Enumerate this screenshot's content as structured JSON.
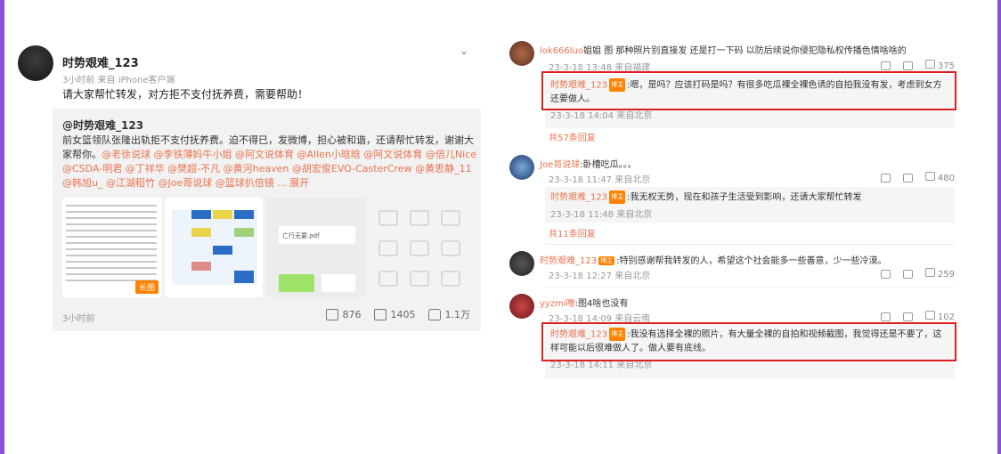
{
  "post": {
    "username": "时势艰难_123",
    "meta": "3小时前 来自 iPhone客户端",
    "text": "请大家帮忙转发，对方拒不支付抚养费，需要帮助！",
    "repost_author": "@时势艰难_123",
    "repost_body_plain": "前女篮领队张隆出轨拒不支付抚养费。迫不得已，发微博，担心被和谐，还请帮忙转发，谢谢大家帮你。",
    "repost_mentions": "@老徐说球 @李铁薄妈牛小姐 @阿文说体育 @Allen小晗晗 @阿文说体育 @倍儿Nice @CSDA-明君 @丁祥华 @樊超-不凡 @黄河heaven @胡宏俊EVO-CasterCrew @黄思静_11 @韩旭u_ @江湖稻竹 @Joe哥说球 @篮球扒倍镜 ... 展开",
    "thumb1_badge": "长图",
    "thumb3_file": "亡行无要.pdf",
    "time": "3小时前",
    "shares": "876",
    "comments": "1405",
    "likes": "1.1万",
    "icons": [
      "chevron-down-icon",
      "share-icon",
      "comment-icon",
      "like-icon"
    ]
  },
  "comments": [
    {
      "name": "lok666luo",
      "text": "姐姐 图 那种照片别直接发 还是打一下码 以防后续说你侵犯隐私权传播色情啥啥的",
      "meta": "23-3-18 13:48 来自福建",
      "likes": "375",
      "reply": {
        "name": "时势艰难_123",
        "badge": "博主",
        "text": ":嗯，是吗？应该打码是吗？有很多吃瓜裸全裸色诱的自拍我没有发，考虑到女方还要做人。",
        "meta": "23-3-18 14:04 来自北京"
      },
      "more": "共57条回复"
    },
    {
      "name": "Joe哥说球",
      "text": ":卧槽吃瓜。。。",
      "meta": "23-3-18 11:47 来自北京",
      "likes": "480",
      "reply": {
        "name": "时势艰难_123",
        "badge": "博主",
        "text": ":我无权无势，现在和孩子生活受到影响，还请大家帮忙转发",
        "meta": "23-3-18 11:48 来自北京"
      },
      "more": "共11条回复"
    },
    {
      "name": "时势艰难_123",
      "badge": "博主",
      "text": ":特别感谢帮我转发的人，希望这个社会能多一些善意，少一些冷漠。",
      "meta": "23-3-18 12:27 来自北京",
      "likes": "259"
    },
    {
      "name": "yyzmi噜",
      "text": ":图4啥也没有",
      "meta": "23-3-18 14:09 来自云南",
      "likes": "102",
      "reply": {
        "name": "时势艰难_123",
        "badge": "博主",
        "text": ":我没有选择全裸的照片，有大量全裸的自拍和视频截图，我觉得还是不要了，这样可能以后很难做人了。做人要有底线。",
        "meta": "23-3-18 14:11 来自北京"
      }
    }
  ],
  "colors": {
    "accent": "#eb7350",
    "highlight_box": "#e02020",
    "frame": "#8a4fd8",
    "badge": "#ff8200"
  }
}
